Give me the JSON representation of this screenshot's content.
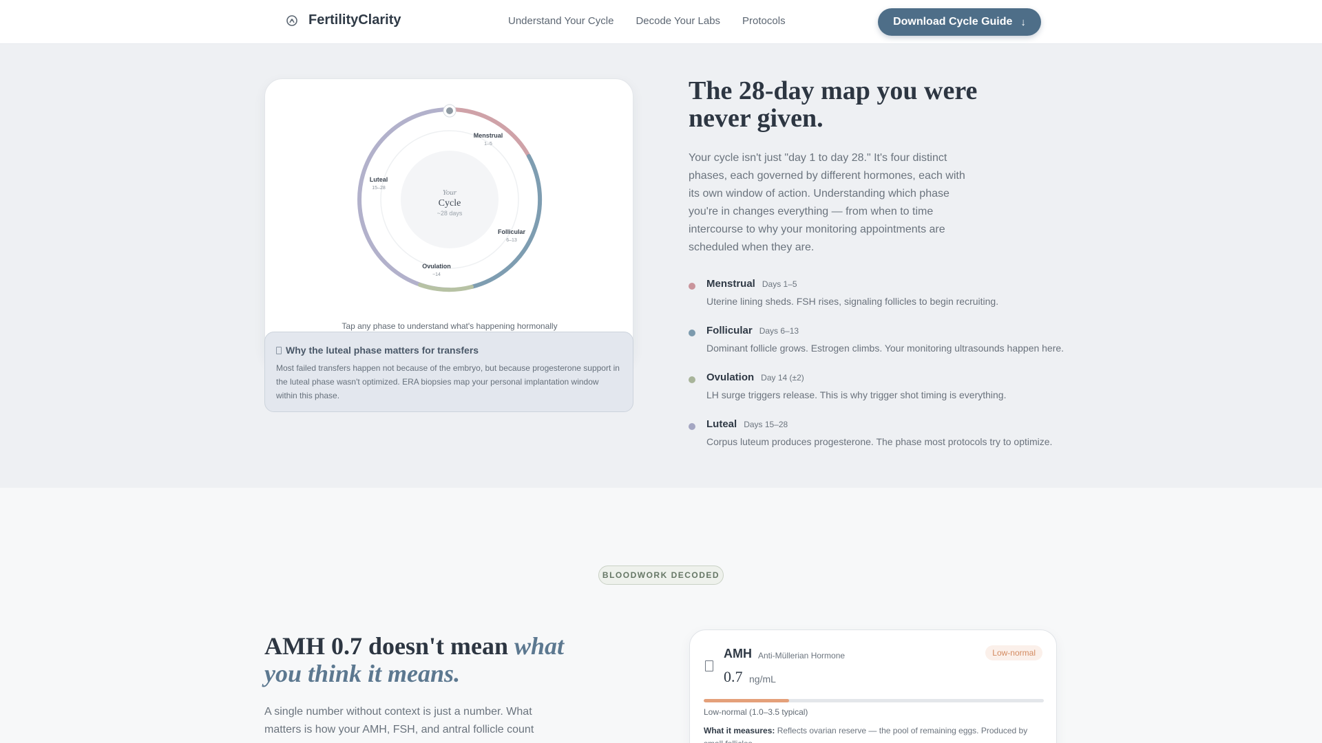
{
  "nav": {
    "brand": "FertilityClarity",
    "links": [
      "Understand Your Cycle",
      "Decode Your Labs",
      "Protocols"
    ],
    "cta_label": "Download Cycle Guide",
    "cta_icon": "arrow-down-icon"
  },
  "cycle_section": {
    "headline": "The 28-day map you were never given.",
    "lead": "Your cycle isn't just \"day 1 to day 28.\" It's four distinct phases, each governed by different hormones, each with its own window of action. Understanding which phase you're in changes everything — from when to time intercourse to why your monitoring appointments are scheduled when they are.",
    "wheel": {
      "center_top": "Your",
      "center_main": "Cycle",
      "center_sub": "~28 days",
      "labels": [
        {
          "name": "Menstrual",
          "days": "1–5"
        },
        {
          "name": "Follicular",
          "days": "6–13"
        },
        {
          "name": "Ovulation",
          "days": "~14"
        },
        {
          "name": "Luteal",
          "days": "15–28"
        }
      ]
    },
    "tap_hint": "Tap any phase to understand what's happening hormonally",
    "info": {
      "title": "Why the luteal phase matters for transfers",
      "text": "Most failed transfers happen not because of the embryo, but because progesterone support in the luteal phase wasn't optimized. ERA biopsies map your personal implantation window within this phase."
    },
    "phases": [
      {
        "name": "Menstrual",
        "days": "Days 1–5",
        "desc": "Uterine lining sheds. FSH rises, signaling follicles to begin recruiting.",
        "color": "#c9949b"
      },
      {
        "name": "Follicular",
        "days": "Days 6–13",
        "desc": "Dominant follicle grows. Estrogen climbs. Your monitoring ultrasounds happen here.",
        "color": "#7c9aad"
      },
      {
        "name": "Ovulation",
        "days": "Day 14 (±2)",
        "desc": "LH surge triggers release. This is why trigger shot timing is everything.",
        "color": "#a8b49a"
      },
      {
        "name": "Luteal",
        "days": "Days 15–28",
        "desc": "Corpus luteum produces progesterone. The phase most protocols try to optimize.",
        "color": "#a4a6c2"
      }
    ]
  },
  "labs_section": {
    "tag": "BLOODWORK DECODED",
    "headline_plain": "AMH 0.7 doesn't mean ",
    "headline_em": "what you think it means.",
    "lead": "A single number without context is just a number. What matters is how your AMH, FSH, and antral follicle count",
    "card": {
      "name": "AMH",
      "full_name": "Anti-Müllerian Hormone",
      "value": "0.7",
      "unit": "ng/mL",
      "badge": "Low-normal",
      "range": "Low-normal (1.0–3.5 typical)",
      "progress": 0.25,
      "measure_label": "What it measures:",
      "measure_text": " Reflects ovarian reserve — the pool of remaining eggs. Produced by small follicles."
    }
  }
}
